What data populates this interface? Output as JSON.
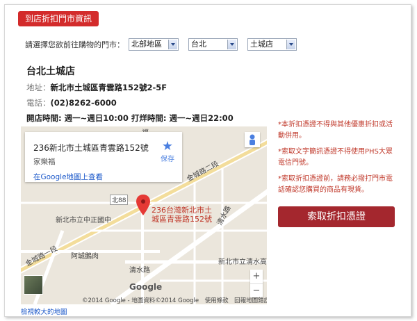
{
  "header": {
    "title_tab": "到店折扣門市資訊"
  },
  "selector": {
    "prompt": "請選擇您欲前往購物的門市：",
    "region": "北部地區",
    "city": "台北",
    "store": "土城店"
  },
  "store": {
    "name": "台北土城店",
    "address_label": "地址：",
    "address": "新北市土城區青雲路152號2-5F",
    "phone_label": "電話：",
    "phone": "(02)8262-6000",
    "hours": "開店時間: 週一~週日10:00 打烊時間: 週一~週日22:00"
  },
  "map": {
    "info_address": "236新北市土城區青雲路152號",
    "info_sub": "家樂福",
    "info_link": "在Google地圖上查看",
    "save_label": "保存",
    "pin_label_line1": "236台灣新北市土",
    "pin_label_line2": "城區青雲路152號",
    "road_labels": {
      "jincheng2": "金城路二段",
      "jincheng1": "金城路一段",
      "qingshui": "清水路",
      "qingshui2": "清水路",
      "bei88": "北88",
      "zhongzheng": "新北市立中正國中",
      "acheng": "阿城鵝肉",
      "qingshui_high": "新北市立清水高",
      "fu": "福"
    },
    "brand": "Google",
    "copyright": "©2014 Google - 地圖資料©2014 Google　使用條款　回報地圖錯誤",
    "zoom_in": "+",
    "zoom_out": "−",
    "larger_map": "檢視較大的地圖"
  },
  "notes": [
    "*本折扣憑證不得與其他優惠折扣或活動併用。",
    "*索取文字簡訊憑證不得使用PHS大眾電信門號。",
    "*索取折扣憑證前，請務必撥打門市電話確認您購買的商品有現貨。"
  ],
  "action": {
    "button_label": "索取折扣憑證"
  },
  "colors": {
    "accent": "#d32b2b",
    "button": "#a4272e",
    "note_text": "#c0392b",
    "link": "#1a57c9"
  }
}
